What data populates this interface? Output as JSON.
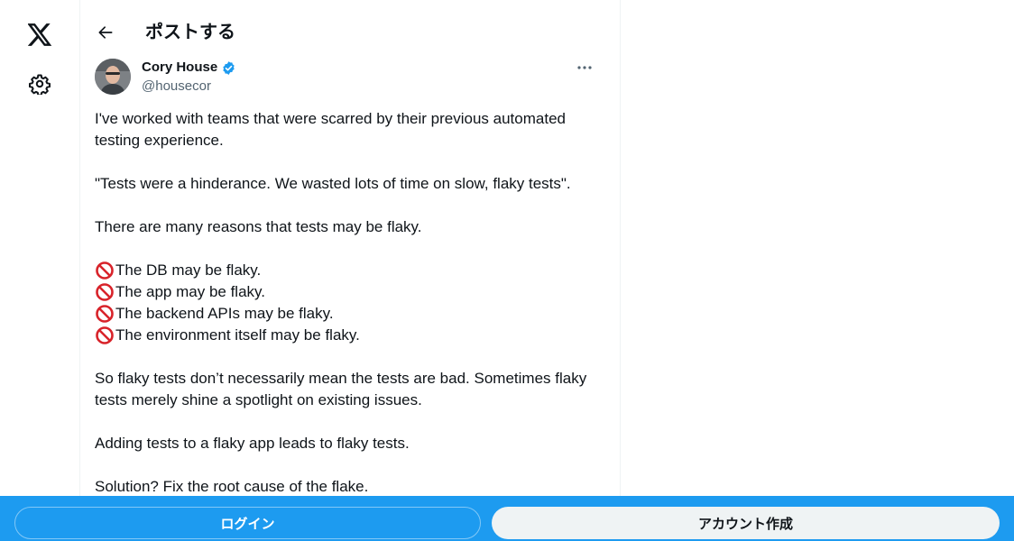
{
  "nav": {
    "logo_icon": "x-logo-icon",
    "settings_icon": "gear-icon"
  },
  "header": {
    "back_icon": "arrow-left-icon",
    "title": "ポストする"
  },
  "post": {
    "author_name": "Cory House",
    "verified": true,
    "handle": "@housecor",
    "more_icon": "more-dots-icon",
    "paragraphs": [
      "I've worked with teams that were scarred by their previous automated testing experience.",
      "\"Tests were a hinderance. We wasted lots of time on slow, flaky tests\".",
      "There are many reasons that tests may be flaky."
    ],
    "bullets": [
      "The DB may be flaky.",
      "The app may be flaky.",
      "The backend APIs may be flaky.",
      "The environment itself may be flaky."
    ],
    "paragraphs_after": [
      "So flaky tests don’t necessarily mean the tests are bad. Sometimes flaky tests merely shine a spotlight on existing issues.",
      "Adding tests to a flaky app leads to flaky tests.",
      "Solution? Fix the root cause of the flake."
    ]
  },
  "bottom_bar": {
    "login_label": "ログイン",
    "signup_label": "アカウント作成"
  },
  "colors": {
    "accent": "#1d9bf0",
    "text": "#0f1419",
    "secondary_text": "#536471",
    "signup_bg": "#eff3f4",
    "ban_red": "#d8232a"
  }
}
